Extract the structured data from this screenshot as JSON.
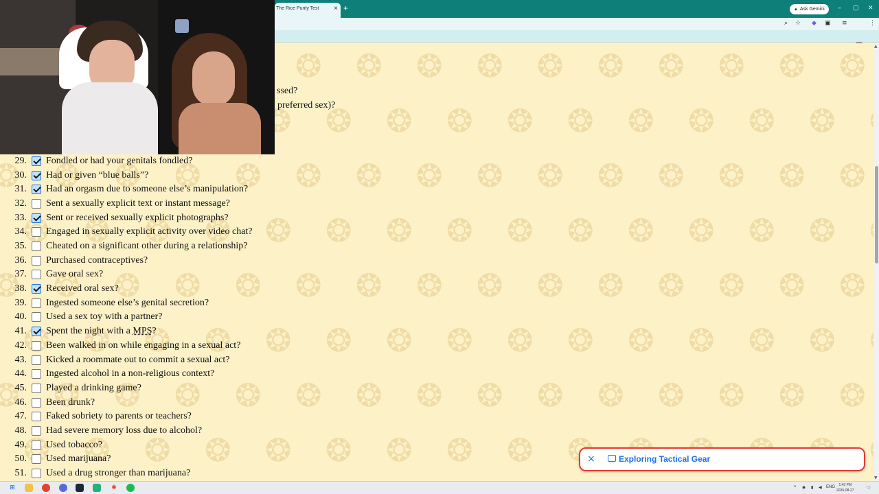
{
  "browser": {
    "tab_title": "The Rice Purity Test",
    "tab_close": "×",
    "new_tab": "+",
    "ask_gemini": "Ask Gemini",
    "window_minimize": "–",
    "window_maximize": "▢",
    "window_close": "✕"
  },
  "page": {
    "partial_lines": [
      "ssed?",
      "preferred sex)?"
    ],
    "questions": [
      {
        "num": "29.",
        "text": "Fondled or had your genitals fondled?",
        "checked": true
      },
      {
        "num": "30.",
        "text": "Had or given “blue balls”?",
        "checked": true
      },
      {
        "num": "31.",
        "text": "Had an orgasm due to someone else’s manipulation?",
        "checked": true
      },
      {
        "num": "32.",
        "text": "Sent a sexually explicit text or instant message?",
        "checked": false
      },
      {
        "num": "33.",
        "text": "Sent or received sexually explicit photographs?",
        "checked": true
      },
      {
        "num": "34.",
        "text": "Engaged in sexually explicit activity over video chat?",
        "checked": false
      },
      {
        "num": "35.",
        "text": "Cheated on a significant other during a relationship?",
        "checked": false
      },
      {
        "num": "36.",
        "text": "Purchased contraceptives?",
        "checked": false
      },
      {
        "num": "37.",
        "text": "Gave oral sex?",
        "checked": false
      },
      {
        "num": "38.",
        "text": "Received oral sex?",
        "checked": true
      },
      {
        "num": "39.",
        "text": "Ingested someone else’s genital secretion?",
        "checked": false
      },
      {
        "num": "40.",
        "text": "Used a sex toy with a partner?",
        "checked": false
      },
      {
        "num": "41.",
        "text_before": "Spent the night with a ",
        "abbr": "MPS",
        "text_after": "?",
        "checked": true
      },
      {
        "num": "42.",
        "text": "Been walked in on while engaging in a sexual act?",
        "checked": false
      },
      {
        "num": "43.",
        "text": "Kicked a roommate out to commit a sexual act?",
        "checked": false
      },
      {
        "num": "44.",
        "text": "Ingested alcohol in a non-religious context?",
        "checked": false
      },
      {
        "num": "45.",
        "text": "Played a drinking game?",
        "checked": false
      },
      {
        "num": "46.",
        "text": "Been drunk?",
        "checked": false
      },
      {
        "num": "47.",
        "text": "Faked sobriety to parents or teachers?",
        "checked": false
      },
      {
        "num": "48.",
        "text": "Had severe memory loss due to alcohol?",
        "checked": false
      },
      {
        "num": "49.",
        "text": "Used tobacco?",
        "checked": false
      },
      {
        "num": "50.",
        "text": "Used marijuana?",
        "checked": false
      },
      {
        "num": "51.",
        "text": "Used a drug stronger than marijuana?",
        "checked": false
      }
    ]
  },
  "toast": {
    "close": "×",
    "icon": "news-icon",
    "text": "Exploring Tactical Gear",
    "border_color": "#e53935",
    "text_color": "#1a73e8"
  },
  "taskbar": {
    "tray_text": "ENG",
    "time": "1:43 PM",
    "date": "2026-08-27"
  },
  "colors": {
    "tabbar": "#0f7f7a",
    "page_background": "#fdf1c8",
    "check_accent": "#1a73e8"
  }
}
